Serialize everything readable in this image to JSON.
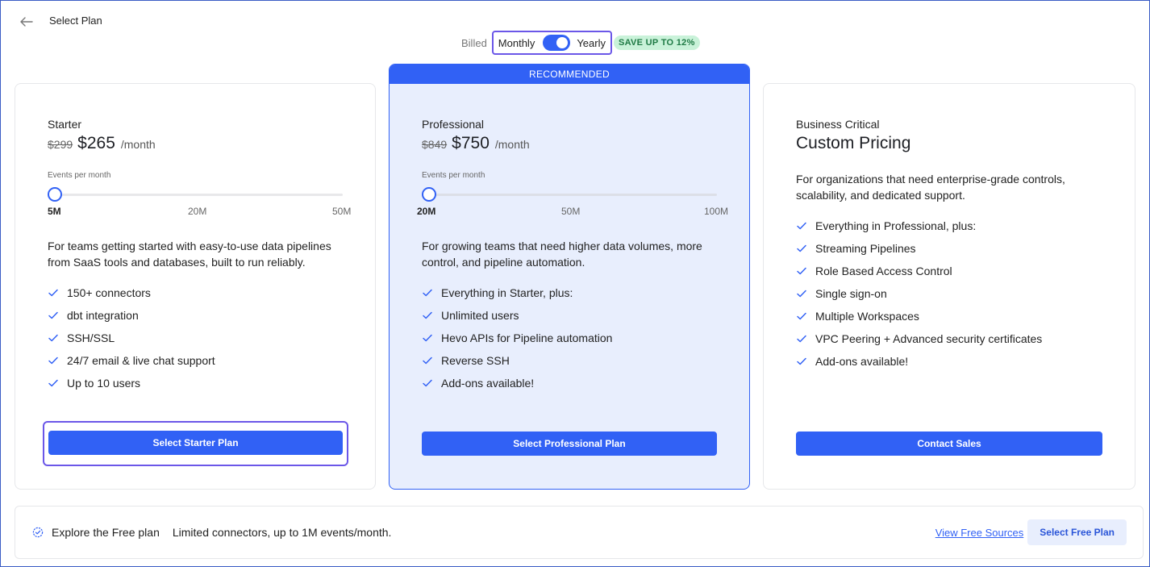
{
  "header": {
    "title": "Select Plan"
  },
  "billing": {
    "billed_label": "Billed",
    "monthly_label": "Monthly",
    "yearly_label": "Yearly",
    "selected": "Yearly",
    "save_badge": "SAVE UP TO 12%"
  },
  "plans": [
    {
      "name": "Starter",
      "old_price": "$299",
      "price": "$265",
      "per": "/month",
      "events_label": "Events per month",
      "ticks": [
        "5M",
        "20M",
        "50M"
      ],
      "slider_value": "5M",
      "description": "For teams getting started with easy-to-use data pipelines from SaaS tools and databases, built to run reliably.",
      "features": [
        "150+ connectors",
        "dbt integration",
        "SSH/SSL",
        "24/7 email & live chat support",
        "Up to 10 users"
      ],
      "button": "Select Starter Plan"
    },
    {
      "name": "Professional",
      "badge": "RECOMMENDED",
      "old_price": "$849",
      "price": "$750",
      "per": "/month",
      "events_label": "Events per month",
      "ticks": [
        "20M",
        "50M",
        "100M"
      ],
      "slider_value": "20M",
      "description": "For growing teams that need higher data volumes, more control, and pipeline automation.",
      "features": [
        "Everything in Starter, plus:",
        "Unlimited users",
        "Hevo APIs for Pipeline automation",
        "Reverse SSH",
        "Add-ons available!"
      ],
      "button": "Select Professional Plan"
    },
    {
      "name": "Business Critical",
      "price": "Custom Pricing",
      "description": "For organizations that need enterprise-grade controls, scalability, and dedicated support.",
      "features": [
        "Everything in Professional, plus:",
        "Streaming Pipelines",
        "Role Based Access Control",
        "Single sign-on",
        "Multiple Workspaces",
        "VPC Peering + Advanced security certificates",
        "Add-ons available!"
      ],
      "button": "Contact Sales"
    }
  ],
  "free_plan": {
    "title": "Explore the Free plan",
    "description": "Limited connectors, up to 1M events/month.",
    "link": "View Free Sources",
    "button": "Select Free Plan"
  },
  "colors": {
    "accent": "#3161f5",
    "focus": "#6b57e8",
    "recommended_bg": "#e8eefd",
    "save_bg": "#c9f2d9"
  }
}
